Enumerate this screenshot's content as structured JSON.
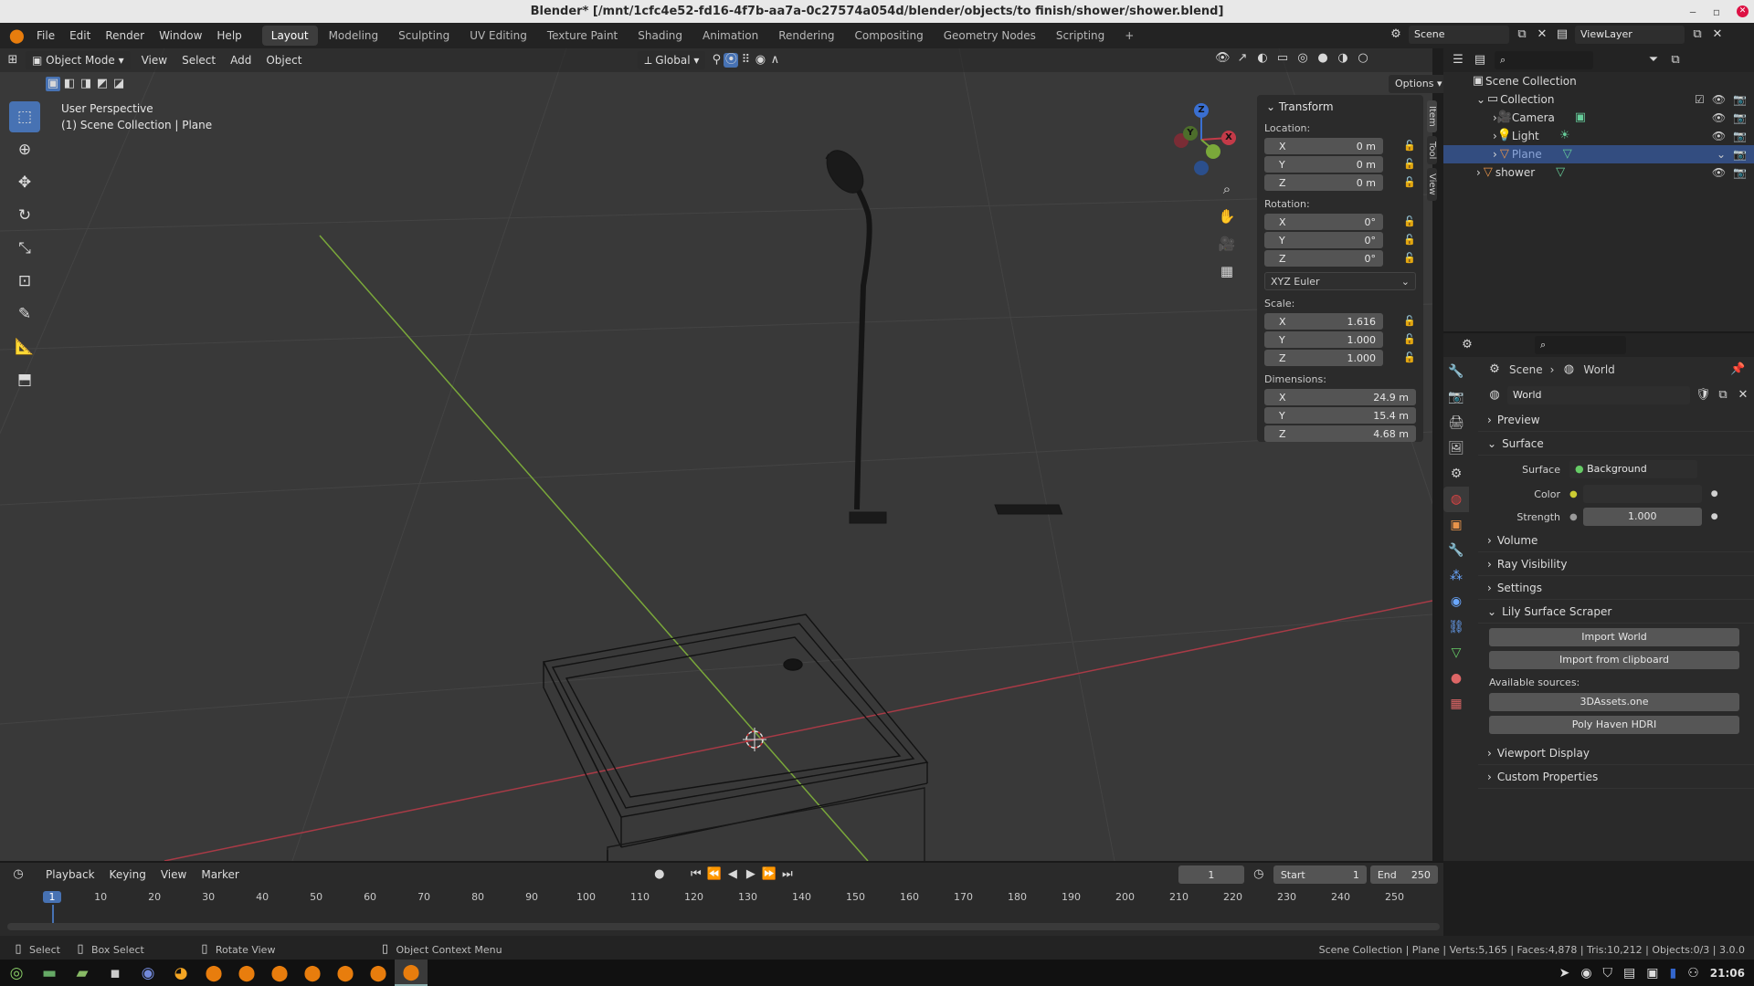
{
  "window": {
    "title": "Blender* [/mnt/1cfc4e52-fd16-4f7b-aa7a-0c27574a054d/blender/objects/to finish/shower/shower.blend]"
  },
  "menu": [
    "File",
    "Edit",
    "Render",
    "Window",
    "Help"
  ],
  "workspaces": [
    "Layout",
    "Modeling",
    "Sculpting",
    "UV Editing",
    "Texture Paint",
    "Shading",
    "Animation",
    "Rendering",
    "Compositing",
    "Geometry Nodes",
    "Scripting"
  ],
  "active_workspace": "Layout",
  "scene": {
    "name": "Scene",
    "view_layer": "ViewLayer"
  },
  "viewport_header": {
    "mode": "Object Mode",
    "menus": [
      "View",
      "Select",
      "Add",
      "Object"
    ],
    "orientation": "Global",
    "options": "Options"
  },
  "viewport_info": {
    "line1": "User Perspective",
    "line2": "(1) Scene Collection | Plane"
  },
  "transform": {
    "title": "Transform",
    "location_label": "Location:",
    "location": {
      "x": "0 m",
      "y": "0 m",
      "z": "0 m"
    },
    "rotation_label": "Rotation:",
    "rotation": {
      "x": "0°",
      "y": "0°",
      "z": "0°"
    },
    "rotation_mode": "XYZ Euler",
    "scale_label": "Scale:",
    "scale": {
      "x": "1.616",
      "y": "1.000",
      "z": "1.000"
    },
    "dimensions_label": "Dimensions:",
    "dimensions": {
      "x": "24.9 m",
      "y": "15.4 m",
      "z": "4.68 m"
    },
    "axis": {
      "x": "X",
      "y": "Y",
      "z": "Z"
    }
  },
  "n_tabs": [
    "Item",
    "Tool",
    "View"
  ],
  "gizmo": {
    "x": "X",
    "y": "Y",
    "z": "Z"
  },
  "outliner": {
    "root": "Scene Collection",
    "items": [
      {
        "name": "Collection",
        "level": 1
      },
      {
        "name": "Camera",
        "level": 2
      },
      {
        "name": "Light",
        "level": 2
      },
      {
        "name": "Plane",
        "level": 2
      },
      {
        "name": "shower",
        "level": 1
      }
    ]
  },
  "properties": {
    "breadcrumb_scene": "Scene",
    "breadcrumb_world": "World",
    "world_name": "World",
    "sections": {
      "preview": "Preview",
      "surface": "Surface",
      "volume": "Volume",
      "ray_visibility": "Ray Visibility",
      "settings": "Settings",
      "lily": "Lily Surface Scraper",
      "viewport_display": "Viewport Display",
      "custom_properties": "Custom Properties"
    },
    "surface_label": "Surface",
    "surface_value": "Background",
    "color_label": "Color",
    "strength_label": "Strength",
    "strength_value": "1.000",
    "lily_buttons": [
      "Import World",
      "Import from clipboard"
    ],
    "available_sources_label": "Available sources:",
    "sources": [
      "3DAssets.one",
      "Poly Haven HDRI"
    ]
  },
  "timeline": {
    "menus": [
      "Playback",
      "Keying",
      "View",
      "Marker"
    ],
    "current_frame": "1",
    "start_label": "Start",
    "start": "1",
    "end_label": "End",
    "end": "250",
    "ruler": [
      "1",
      "10",
      "20",
      "30",
      "40",
      "50",
      "60",
      "70",
      "80",
      "90",
      "100",
      "110",
      "120",
      "130",
      "140",
      "150",
      "160",
      "170",
      "180",
      "190",
      "200",
      "210",
      "220",
      "230",
      "240",
      "250"
    ]
  },
  "statusbar": {
    "select": "Select",
    "box_select": "Box Select",
    "rotate_view": "Rotate View",
    "context_menu": "Object Context Menu",
    "stats": "Scene Collection | Plane | Verts:5,165 | Faces:4,878 | Tris:10,212 | Objects:0/3 | 3.0.0"
  },
  "taskbar": {
    "time": "21:06"
  },
  "colors": {
    "accent": "#4772b3",
    "x_axis": "#c33a48",
    "y_axis": "#7aa83a",
    "z_axis": "#3a6fd1",
    "selected_row": "#334d80"
  }
}
